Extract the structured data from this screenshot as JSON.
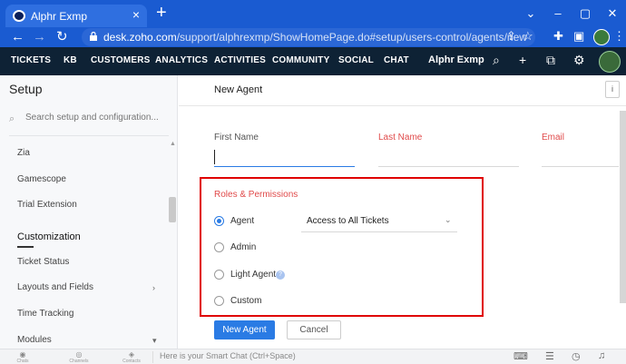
{
  "browser": {
    "tab_title": "Alphr Exmp",
    "url_host": "desk.zoho.com",
    "url_path": "/support/alphrexmp/ShowHomePage.do#setup/users-control/agents/new"
  },
  "appbar": {
    "nav": [
      "TICKETS",
      "KB",
      "CUSTOMERS",
      "ANALYTICS",
      "ACTIVITIES",
      "COMMUNITY",
      "SOCIAL",
      "CHAT"
    ],
    "org_name": "Alphr Exmp"
  },
  "sidebar": {
    "title": "Setup",
    "search_placeholder": "Search setup and configuration...",
    "items_top": [
      "Zia",
      "Gamescope",
      "Trial Extension"
    ],
    "group_title": "Customization",
    "items_group": [
      "Ticket Status",
      "Layouts and Fields",
      "Time Tracking",
      "Modules"
    ]
  },
  "main": {
    "page_title": "New Agent",
    "info_label": "i",
    "fields": {
      "first_name": "First Name",
      "last_name": "Last Name",
      "email": "Email"
    },
    "roles": {
      "title": "Roles & Permissions",
      "options": [
        "Agent",
        "Admin",
        "Light Agent",
        "Custom"
      ],
      "selected": "Agent",
      "access_value": "Access to All Tickets"
    },
    "buttons": {
      "primary": "New Agent",
      "secondary": "Cancel"
    }
  },
  "footer": {
    "items": [
      "Chats",
      "Channels",
      "Contacts"
    ],
    "chat_placeholder": "Here is your Smart Chat (Ctrl+Space)"
  },
  "colors": {
    "browser_blue": "#1a5bd1",
    "appbar_navy": "#0e2235",
    "accent_blue": "#2a7be4",
    "required_red": "#e04a4a",
    "highlight_red": "#e00000"
  }
}
